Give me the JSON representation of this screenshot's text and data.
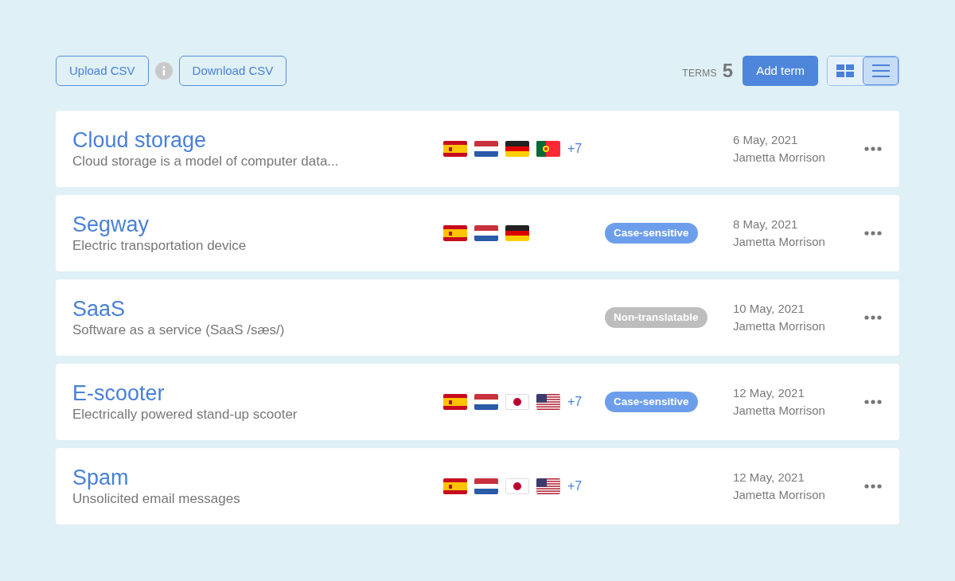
{
  "toolbar": {
    "upload_button": "Upload CSV",
    "download_button": "Download CSV",
    "terms_label": "TERMS",
    "terms_count": "5",
    "add_button": "Add term",
    "views": [
      {
        "kind": "grid",
        "selected": false
      },
      {
        "kind": "list",
        "selected": true
      }
    ]
  },
  "terms": [
    {
      "title": "Cloud storage",
      "description": "Cloud storage is a model of computer data...",
      "flags": [
        {
          "kind": "es"
        },
        {
          "kind": "nl"
        },
        {
          "kind": "de"
        },
        {
          "kind": "pt"
        }
      ],
      "more": "+7",
      "date": "6 May, 2021",
      "author": "Jametta Morrison"
    },
    {
      "title": "Segway",
      "description": "Electric transportation device",
      "flags": [
        {
          "kind": "es"
        },
        {
          "kind": "nl"
        },
        {
          "kind": "de"
        }
      ],
      "tag": {
        "label": "Case-sensitive",
        "color": "#6d9eeb"
      },
      "date": "8 May, 2021",
      "author": "Jametta Morrison"
    },
    {
      "title": "SaaS",
      "description": "Software as a service (SaaS /sæs/)",
      "tag": {
        "label": "Non-translatable",
        "color": "#bdbdbd"
      },
      "date": "10 May, 2021",
      "author": "Jametta Morrison"
    },
    {
      "title": "E-scooter",
      "description": "Electrically powered stand-up scooter",
      "flags": [
        {
          "kind": "es"
        },
        {
          "kind": "nl"
        },
        {
          "kind": "jp"
        },
        {
          "kind": "us"
        }
      ],
      "more": "+7",
      "tag": {
        "label": "Case-sensitive",
        "color": "#6d9eeb"
      },
      "date": "12 May, 2021",
      "author": "Jametta Morrison"
    },
    {
      "title": "Spam",
      "description": "Unsolicited email messages",
      "flags": [
        {
          "kind": "es"
        },
        {
          "kind": "nl"
        },
        {
          "kind": "jp"
        },
        {
          "kind": "us"
        }
      ],
      "more": "+7",
      "date": "12 May, 2021",
      "author": "Jametta Morrison"
    }
  ]
}
